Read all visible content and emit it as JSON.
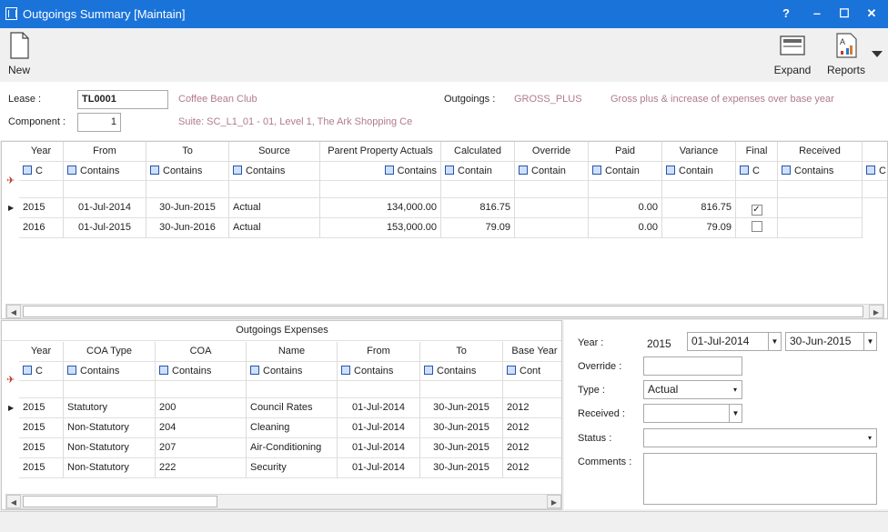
{
  "window": {
    "title": "Outgoings Summary [Maintain]",
    "help": "?",
    "minimize": "‒",
    "maximize": "☐",
    "close": "✕"
  },
  "toolbar": {
    "new_label": "New",
    "expand_label": "Expand",
    "reports_label": "Reports"
  },
  "header": {
    "lease_label": "Lease :",
    "lease_value": "TL0001",
    "tenant_name": "Coffee Bean Club",
    "outgoings_label": "Outgoings :",
    "outgoings_code": "GROSS_PLUS",
    "outgoings_desc": "Gross plus & increase of expenses over base year",
    "component_label": "Component :",
    "component_value": "1",
    "suite_text": "Suite: SC_L1_01 - 01, Level 1, The Ark Shopping Ce"
  },
  "summary_grid": {
    "columns": [
      "Year",
      "From",
      "To",
      "Source",
      "Parent Property Actuals",
      "Calculated",
      "Override",
      "Paid",
      "Variance",
      "Final",
      "Received"
    ],
    "filters": [
      "C",
      "Contains",
      "Contains",
      "Contains",
      "Contains",
      "Contain",
      "Contain",
      "Contain",
      "Contain",
      "C",
      "Contains",
      "C"
    ],
    "rows": [
      {
        "year": "2015",
        "from": "01-Jul-2014",
        "to": "30-Jun-2015",
        "source": "Actual",
        "ppa": "134,000.00",
        "calculated": "816.75",
        "override": "",
        "paid": "0.00",
        "variance": "816.75",
        "final": "✓",
        "received": ""
      },
      {
        "year": "2016",
        "from": "01-Jul-2015",
        "to": "30-Jun-2016",
        "source": "Actual",
        "ppa": "153,000.00",
        "calculated": "79.09",
        "override": "",
        "paid": "0.00",
        "variance": "79.09",
        "final": "",
        "received": ""
      }
    ]
  },
  "expenses_grid": {
    "group_title": "Outgoings Expenses",
    "columns": [
      "Year",
      "COA Type",
      "COA",
      "Name",
      "From",
      "To",
      "Base Year"
    ],
    "filters": [
      "C",
      "Contains",
      "Contains",
      "Contains",
      "Contains",
      "Contains",
      "Cont"
    ],
    "rows": [
      {
        "year": "2015",
        "coa_type": "Statutory",
        "coa": "200",
        "name": "Council Rates",
        "from": "01-Jul-2014",
        "to": "30-Jun-2015",
        "base_year": "2012"
      },
      {
        "year": "2015",
        "coa_type": "Non-Statutory",
        "coa": "204",
        "name": "Cleaning",
        "from": "01-Jul-2014",
        "to": "30-Jun-2015",
        "base_year": "2012"
      },
      {
        "year": "2015",
        "coa_type": "Non-Statutory",
        "coa": "207",
        "name": "Air-Conditioning",
        "from": "01-Jul-2014",
        "to": "30-Jun-2015",
        "base_year": "2012"
      },
      {
        "year": "2015",
        "coa_type": "Non-Statutory",
        "coa": "222",
        "name": "Security",
        "from": "01-Jul-2014",
        "to": "30-Jun-2015",
        "base_year": "2012"
      }
    ]
  },
  "detail": {
    "year_label": "Year :",
    "year_value": "2015",
    "from_value": "01-Jul-2014",
    "to_value": "30-Jun-2015",
    "override_label": "Override :",
    "override_value": "",
    "type_label": "Type :",
    "type_value": "Actual",
    "received_label": "Received :",
    "received_value": "",
    "status_label": "Status :",
    "status_value": "",
    "comments_label": "Comments :",
    "comments_value": ""
  }
}
